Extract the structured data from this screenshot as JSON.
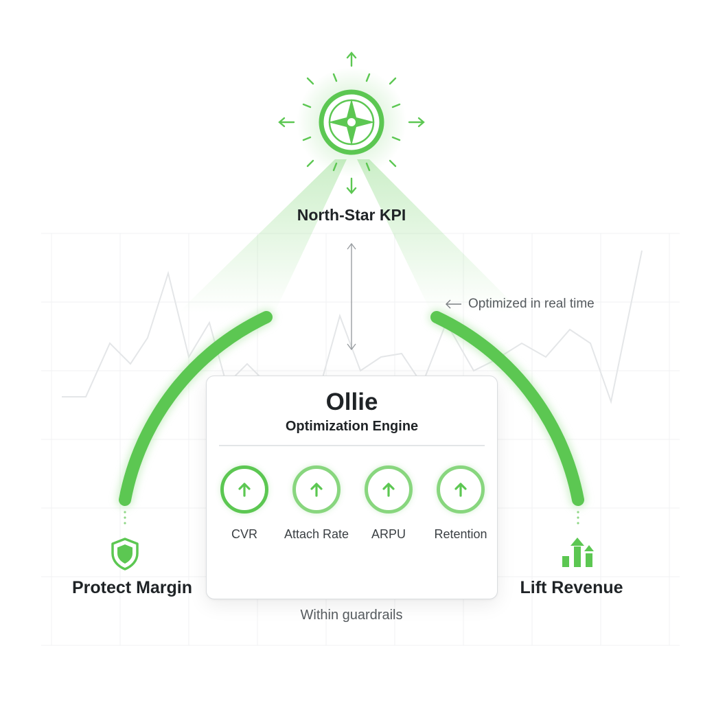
{
  "north_star": {
    "label": "North-Star KPI",
    "icon": "compass-icon"
  },
  "annotation": {
    "arrow": "←",
    "text": "Optimized in real time"
  },
  "engine": {
    "title": "Ollie",
    "subtitle": "Optimization Engine",
    "metrics": [
      {
        "label": "CVR",
        "icon": "arrow-up-icon"
      },
      {
        "label": "Attach Rate",
        "icon": "arrow-up-icon"
      },
      {
        "label": "ARPU",
        "icon": "arrow-up-icon"
      },
      {
        "label": "Retention",
        "icon": "arrow-up-icon"
      }
    ]
  },
  "left_goal": {
    "label": "Protect Margin",
    "icon": "shield-icon"
  },
  "right_goal": {
    "label": "Lift Revenue",
    "icon": "growth-bars-icon"
  },
  "footer": {
    "text": "Within guardrails"
  },
  "colors": {
    "accent": "#5cc752",
    "accent_light": "#a6e09e",
    "text": "#1f2326",
    "muted_text": "#555a5e",
    "grid": "#f1f2f3"
  }
}
